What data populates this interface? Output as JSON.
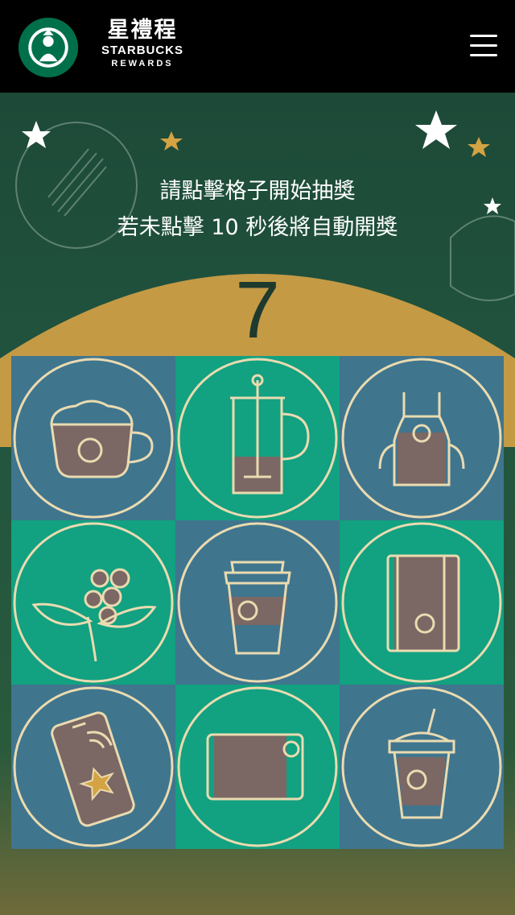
{
  "header": {
    "brand_zh": "星禮程",
    "brand_en": "STARBUCKS",
    "brand_sub": "REWARDS",
    "logo_icon": "starbucks-siren-logo",
    "menu_icon": "hamburger-menu-icon"
  },
  "game": {
    "instruction_line1": "請點擊格子開始抽獎",
    "instruction_line2": "若未點擊 10 秒後將自動開獎",
    "countdown": "7"
  },
  "grid": {
    "cells": [
      {
        "icon": "latte-cup-icon",
        "color": "blue"
      },
      {
        "icon": "french-press-icon",
        "color": "green"
      },
      {
        "icon": "apron-icon",
        "color": "blue"
      },
      {
        "icon": "coffee-cherry-branch-icon",
        "color": "green"
      },
      {
        "icon": "to-go-cup-icon",
        "color": "blue"
      },
      {
        "icon": "notebook-icon",
        "color": "green"
      },
      {
        "icon": "mobile-phone-star-icon",
        "color": "blue"
      },
      {
        "icon": "starbucks-card-icon",
        "color": "green"
      },
      {
        "icon": "frappuccino-cup-icon",
        "color": "blue"
      }
    ]
  },
  "colors": {
    "header_bg": "#000000",
    "stage_green": "#21553f",
    "gold": "#c49a45",
    "cell_blue": "#40758e",
    "cell_green": "#12a181",
    "ring": "#eadbb0",
    "icon_fill": "#7b6764",
    "countdown": "#1e3a2e"
  }
}
